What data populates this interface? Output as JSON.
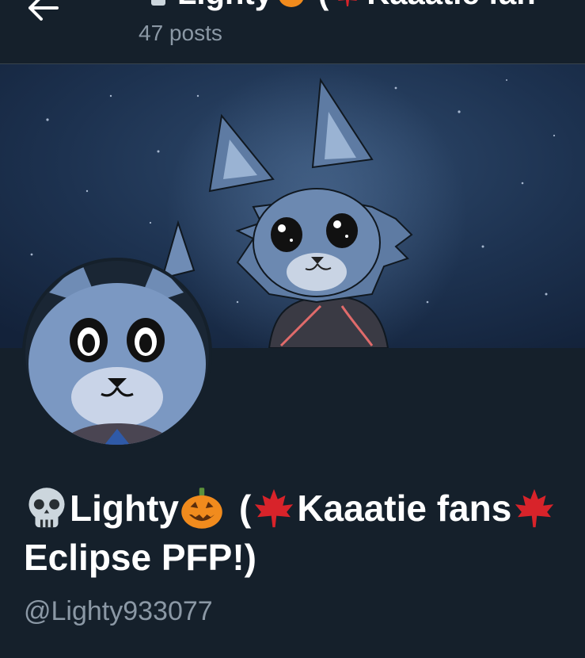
{
  "header": {
    "back_icon": "arrow-left-icon",
    "title": "Lighty",
    "title_paren_open": "(",
    "title_partial": "Kaaatie fan",
    "post_count": "47 posts"
  },
  "banner": {
    "description_icon": "banner-artwork"
  },
  "profile": {
    "avatar_icon": "avatar-image",
    "name_part_1": "Lighty",
    "name_part_2": "(",
    "name_part_3": "Kaaatie fans",
    "name_line_2": "Eclipse PFP!)",
    "handle": "@Lighty933077"
  },
  "icons": {
    "skull": "skull-emoji-icon",
    "pumpkin": "jack-o-lantern-emoji-icon",
    "maple": "maple-leaf-emoji-icon"
  },
  "colors": {
    "background": "#15202b",
    "divider": "#38444d",
    "secondary_text": "#8b98a5",
    "primary_text": "#ffffff",
    "maple_red": "#d8232a",
    "pumpkin_orange": "#f18b1d"
  }
}
